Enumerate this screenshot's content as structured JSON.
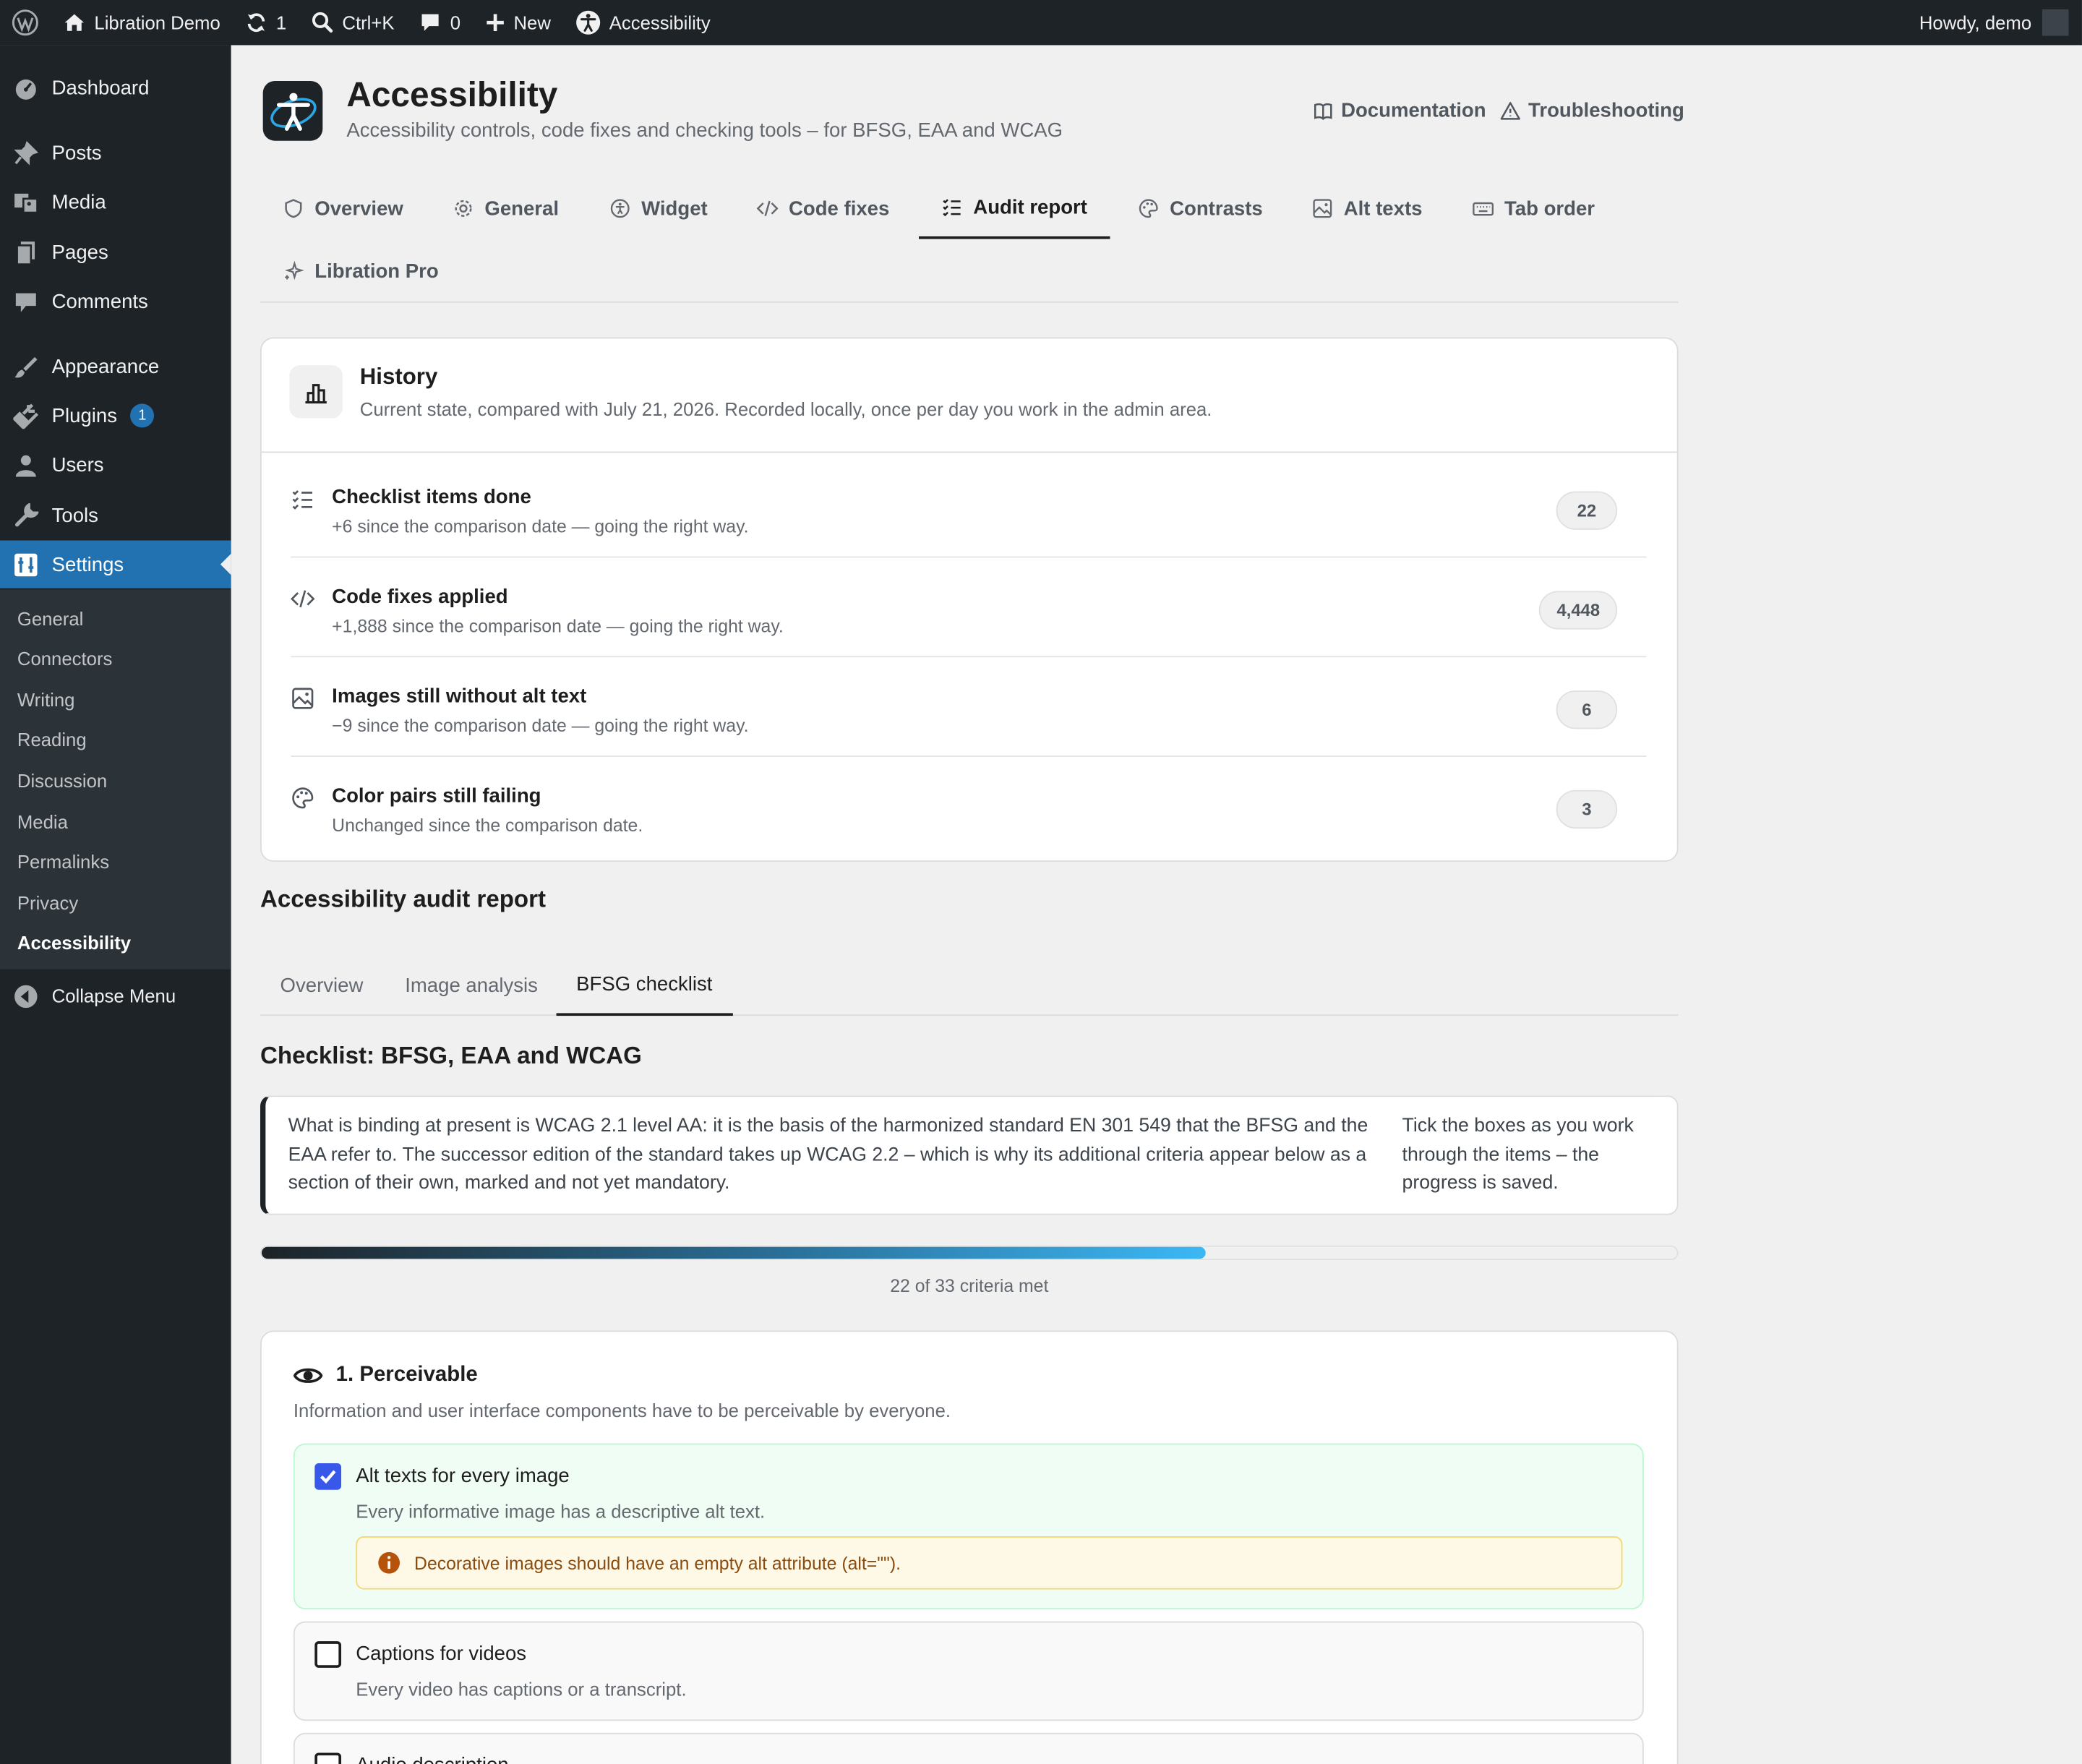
{
  "adminbar": {
    "site_name": "Libration Demo",
    "updates_count": "1",
    "search_shortcut": "Ctrl+K",
    "comments_count": "0",
    "new_label": "New",
    "accessibility_label": "Accessibility",
    "howdy": "Howdy, demo"
  },
  "sidebar": {
    "dashboard": "Dashboard",
    "posts": "Posts",
    "media": "Media",
    "pages": "Pages",
    "comments": "Comments",
    "appearance": "Appearance",
    "plugins": "Plugins",
    "plugins_badge": "1",
    "users": "Users",
    "tools": "Tools",
    "settings": "Settings",
    "submenu": [
      "General",
      "Connectors",
      "Writing",
      "Reading",
      "Discussion",
      "Media",
      "Permalinks",
      "Privacy",
      "Accessibility"
    ],
    "collapse": "Collapse Menu"
  },
  "header": {
    "title": "Accessibility",
    "subtitle": "Accessibility controls, code fixes and checking tools – for BFSG, EAA and WCAG",
    "documentation": "Documentation",
    "troubleshooting": "Troubleshooting"
  },
  "tabs": [
    "Overview",
    "General",
    "Widget",
    "Code fixes",
    "Audit report",
    "Contrasts",
    "Alt texts",
    "Tab order",
    "Libration Pro"
  ],
  "history": {
    "title": "History",
    "subtitle": "Current state, compared with July 21, 2026. Recorded locally, once per day you work in the admin area.",
    "rows": [
      {
        "title": "Checklist items done",
        "desc": "+6 since the comparison date — going the right way.",
        "value": "22"
      },
      {
        "title": "Code fixes applied",
        "desc": "+1,888 since the comparison date — going the right way.",
        "value": "4,448"
      },
      {
        "title": "Images still without alt text",
        "desc": "−9 since the comparison date — going the right way.",
        "value": "6"
      },
      {
        "title": "Color pairs still failing",
        "desc": "Unchanged since the comparison date.",
        "value": "3"
      }
    ]
  },
  "audit": {
    "title": "Accessibility audit report",
    "subtabs": [
      "Overview",
      "Image analysis",
      "BFSG checklist"
    ]
  },
  "checklist": {
    "title": "Checklist: BFSG, EAA and WCAG",
    "intro": "What is binding at present is WCAG 2.1 level AA: it is the basis of the harmonized standard EN 301 549 that the BFSG and the EAA refer to. The successor edition of the standard takes up WCAG 2.2 – which is why its additional criteria appear below as a section of their own, marked and not yet mandatory.",
    "side_note": "Tick the boxes as you work through the items – the progress is saved.",
    "progress_fraction": 0.6667,
    "progress_label": "22 of 33 criteria met"
  },
  "perceivable": {
    "title": "1. Perceivable",
    "subtitle": "Information and user interface components have to be perceivable by everyone.",
    "criteria": [
      {
        "title": "Alt texts for every image",
        "desc": "Every informative image has a descriptive alt text.",
        "hint": "Decorative images should have an empty alt attribute (alt=\"\").",
        "checked": true
      },
      {
        "title": "Captions for videos",
        "desc": "Every video has captions or a transcript.",
        "checked": false
      },
      {
        "title": "Audio description",
        "checked": false
      }
    ]
  },
  "colors": {
    "accent": "#3858e9",
    "admin_dark": "#1d2327",
    "wp_blue": "#2271b1"
  }
}
